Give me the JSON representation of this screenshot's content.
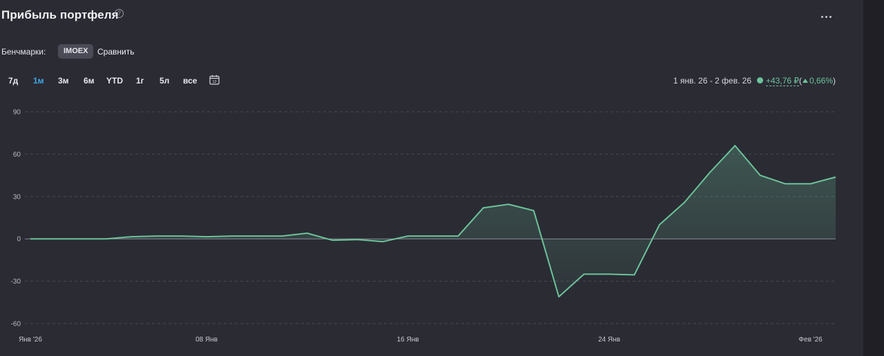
{
  "header": {
    "title": "Прибыль портфеля",
    "help_icon": "question-circle-icon",
    "more_icon": "more-horizontal-icon"
  },
  "benchmarks": {
    "label": "Бенчмарки:",
    "chip": "IMOEX",
    "compare": "Сравнить"
  },
  "periods": [
    {
      "label": "7д",
      "active": false
    },
    {
      "label": "1м",
      "active": true
    },
    {
      "label": "3м",
      "active": false
    },
    {
      "label": "6м",
      "active": false
    },
    {
      "label": "YTD",
      "active": false
    },
    {
      "label": "1г",
      "active": false
    },
    {
      "label": "5л",
      "active": false
    },
    {
      "label": "все",
      "active": false
    }
  ],
  "calendar_icon": "calendar-icon",
  "summary": {
    "range": "1 янв. 26 - 2 фев. 26",
    "profit": "+43,76 ₽",
    "pct": "0,66%",
    "open_paren": "(",
    "close_paren": ")"
  },
  "colors": {
    "background": "#2b2b34",
    "line": "#6cc49a",
    "accent": "#3fa7e6"
  },
  "chart_data": {
    "type": "area",
    "title": "",
    "xlabel": "",
    "ylabel": "",
    "ylim": [
      -60,
      90
    ],
    "yticks": [
      90,
      60,
      30,
      0,
      -30,
      -60
    ],
    "xtick_labels": [
      "Янв '26",
      "08 Янв",
      "16 Янв",
      "24 Янв",
      "Фев '26"
    ],
    "xtick_days": [
      1,
      8,
      16,
      24,
      32
    ],
    "grid": true,
    "series": [
      {
        "x": [
          1,
          2,
          3,
          4,
          5,
          6,
          7,
          8,
          9,
          10,
          11,
          12,
          13,
          14,
          15,
          16,
          17,
          18,
          19,
          20,
          21,
          22,
          23,
          24,
          25,
          26,
          27,
          28,
          29,
          30,
          31,
          32,
          33
        ],
        "values": [
          0,
          0,
          0,
          0,
          1.5,
          2,
          2,
          1.5,
          2,
          2,
          2,
          4,
          -1,
          -0.5,
          -2,
          2,
          2,
          2,
          22,
          24.5,
          20,
          -41,
          -25,
          -25,
          -25.5,
          10,
          26,
          47,
          66,
          45,
          39,
          39,
          43.8
        ]
      }
    ]
  }
}
